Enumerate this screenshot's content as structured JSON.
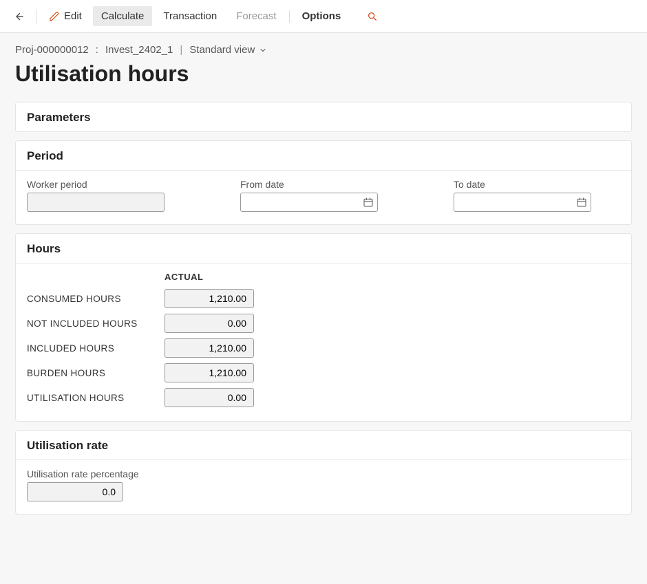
{
  "toolbar": {
    "edit": "Edit",
    "calculate": "Calculate",
    "transaction": "Transaction",
    "forecast": "Forecast",
    "options": "Options"
  },
  "header": {
    "project_code": "Proj-000000012",
    "project_name": "Invest_2402_1",
    "view_label": "Standard view",
    "page_title": "Utilisation hours"
  },
  "sections": {
    "parameters": {
      "title": "Parameters"
    },
    "period": {
      "title": "Period",
      "worker_period_label": "Worker period",
      "from_date_label": "From date",
      "to_date_label": "To date",
      "worker_period_value": "",
      "from_date_value": "",
      "to_date_value": ""
    },
    "hours": {
      "title": "Hours",
      "column_header": "ACTUAL",
      "rows": {
        "consumed": {
          "label": "CONSUMED HOURS",
          "value": "1,210.00"
        },
        "not_included": {
          "label": "NOT INCLUDED HOURS",
          "value": "0.00"
        },
        "included": {
          "label": "INCLUDED HOURS",
          "value": "1,210.00"
        },
        "burden": {
          "label": "BURDEN HOURS",
          "value": "1,210.00"
        },
        "utilisation": {
          "label": "UTILISATION HOURS",
          "value": "0.00"
        }
      }
    },
    "rate": {
      "title": "Utilisation rate",
      "label": "Utilisation rate percentage",
      "value": "0.0"
    }
  }
}
